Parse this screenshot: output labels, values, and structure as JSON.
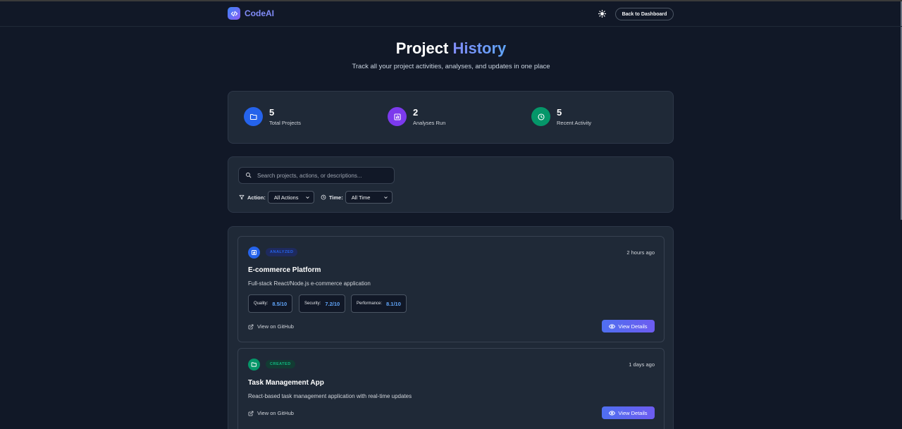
{
  "nav": {
    "brand": "CodeAI",
    "back_label": "Back to Dashboard"
  },
  "header": {
    "title_main": "Project",
    "title_accent": "History",
    "subtitle": "Track all your project activities, analyses, and updates in one place"
  },
  "stats": [
    {
      "value": "5",
      "label": "Total Projects",
      "icon": "folder-icon",
      "color": "#2563eb"
    },
    {
      "value": "2",
      "label": "Analyses Run",
      "icon": "bar-chart-icon",
      "color": "#7c3aed"
    },
    {
      "value": "5",
      "label": "Recent Activity",
      "icon": "clock-icon",
      "color": "#059669"
    }
  ],
  "filters": {
    "search_placeholder": "Search projects, actions, or descriptions...",
    "action_label": "Action:",
    "action_value": "All Actions",
    "time_label": "Time:",
    "time_value": "All Time"
  },
  "activities": [
    {
      "badge": "ANALYZED",
      "badge_color": "#1e3a8a",
      "badge_text_color": "#3b82f6",
      "icon": "bar-chart-icon",
      "icon_color": "#2563eb",
      "time": "2 hours ago",
      "title": "E-commerce Platform",
      "description": "Full-stack React/Node.js e-commerce application",
      "metrics": [
        {
          "label": "Quality:",
          "value": "8.5/10"
        },
        {
          "label": "Security:",
          "value": "7.2/10"
        },
        {
          "label": "Performance:",
          "value": "8.1/10"
        }
      ],
      "github_label": "View on GitHub",
      "view_label": "View Details"
    },
    {
      "badge": "CREATED",
      "badge_color": "#064e3b",
      "badge_text_color": "#10b981",
      "icon": "folder-icon",
      "icon_color": "#059669",
      "time": "1 days ago",
      "title": "Task Management App",
      "description": "React-based task management application with real-time updates",
      "github_label": "View on GitHub",
      "view_label": "View Details"
    }
  ]
}
